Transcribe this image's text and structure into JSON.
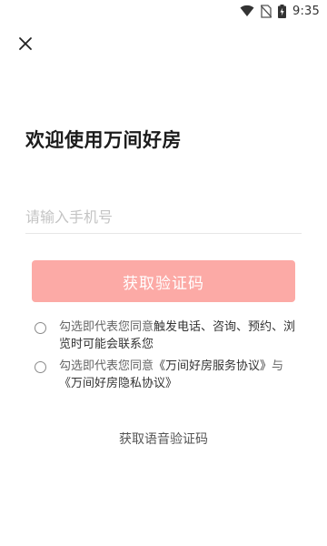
{
  "status_bar": {
    "time": "9:35",
    "icons": [
      "wifi-icon",
      "no-sim-icon",
      "battery-charging-icon"
    ]
  },
  "header": {
    "close_icon": "close-icon"
  },
  "main": {
    "title": "欢迎使用万间好房",
    "phone_placeholder": "请输入手机号",
    "code_button_label": "获取验证码",
    "code_button_color": "#fcaaa6",
    "agreement_contact": {
      "prefix": "勾选即代表您同意",
      "text": "触发电话、咨询、预约、浏览时可能会联系您"
    },
    "agreement_terms": {
      "prefix": "勾选即代表您同意",
      "service_link": "《万间好房服务协议》",
      "joiner": "与",
      "privacy_link": "《万间好房隐私协议》"
    },
    "voice_code_link": "获取语音验证码"
  }
}
